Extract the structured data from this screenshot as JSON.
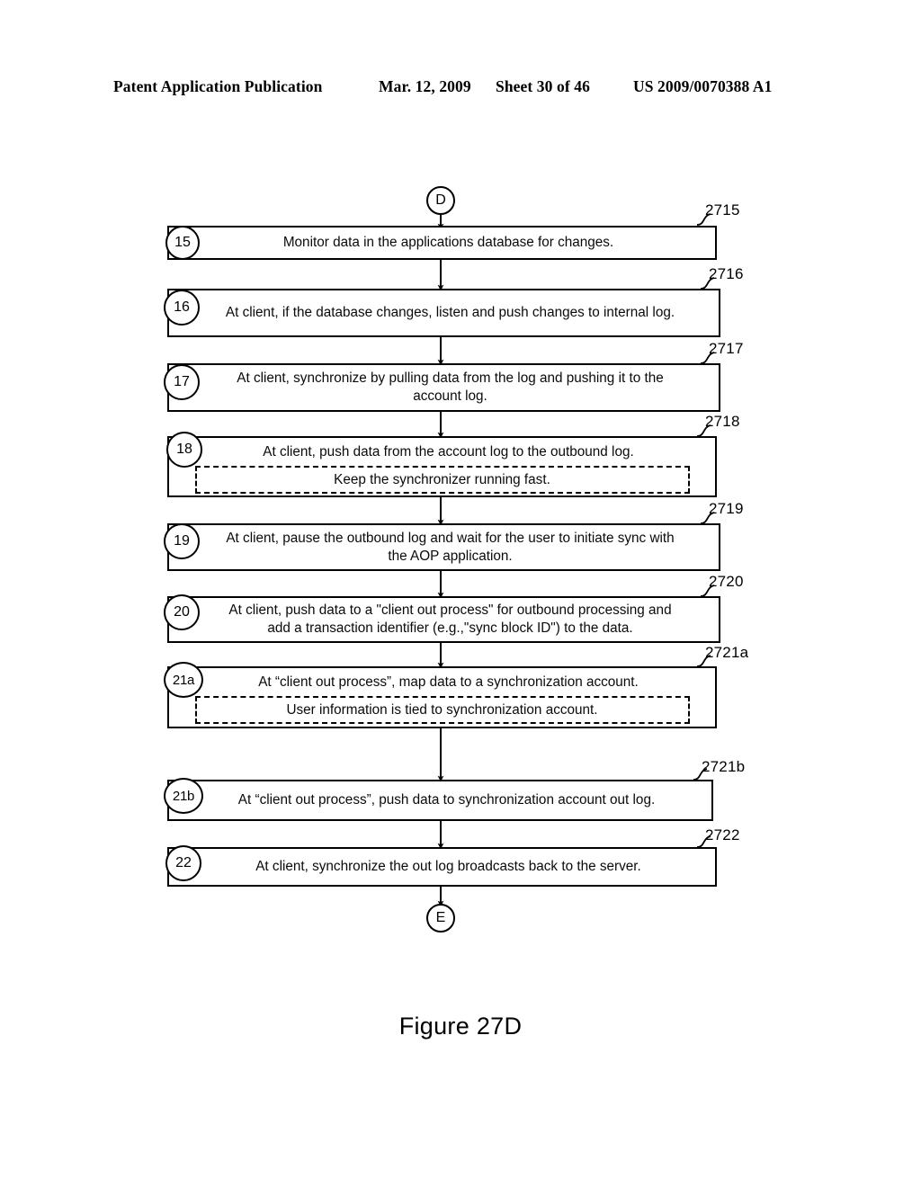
{
  "header": {
    "publication": "Patent Application Publication",
    "date": "Mar. 12, 2009",
    "sheet": "Sheet 30 of 46",
    "publication_number": "US 2009/0070388 A1"
  },
  "figure": {
    "caption": "Figure 27D",
    "entry_connector": "D",
    "exit_connector": "E"
  },
  "steps": [
    {
      "number": "15",
      "ref": "2715",
      "text": "Monitor data in the applications database for changes.",
      "note": null
    },
    {
      "number": "16",
      "ref": "2716",
      "text": "At client, if the database changes, listen and push changes to internal log.",
      "note": null
    },
    {
      "number": "17",
      "ref": "2717",
      "text": "At client, synchronize by pulling data from the log and pushing it to the account log.",
      "note": null
    },
    {
      "number": "18",
      "ref": "2718",
      "text": "At client, push data from the account log to the outbound log.",
      "note": "Keep the synchronizer running fast."
    },
    {
      "number": "19",
      "ref": "2719",
      "text": "At client, pause the outbound log and wait for the user to initiate sync with the AOP application.",
      "note": null
    },
    {
      "number": "20",
      "ref": "2720",
      "text": "At client, push data to a \"client out process\" for outbound processing and add a transaction identifier  (e.g.,\"sync block ID\") to the data.",
      "note": null
    },
    {
      "number": "21a",
      "ref": "2721a",
      "text": "At “client out process”, map data to a synchronization account.",
      "note": "User information is tied to synchronization account."
    },
    {
      "number": "21b",
      "ref": "2721b",
      "text": "At “client out process”, push data to synchronization account out log.",
      "note": null
    },
    {
      "number": "22",
      "ref": "2722",
      "text": "At client, synchronize the out log broadcasts back to the server.",
      "note": null
    }
  ]
}
